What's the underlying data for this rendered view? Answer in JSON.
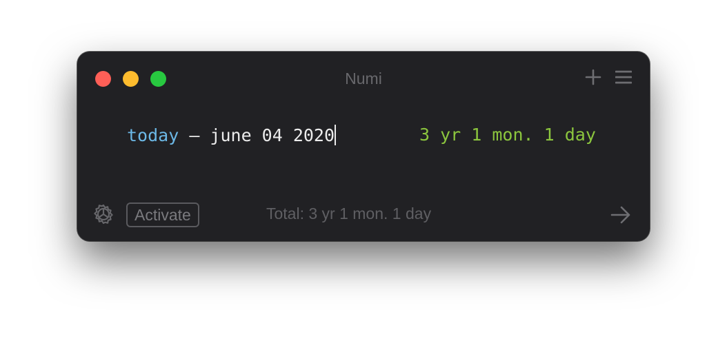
{
  "window": {
    "title": "Numi",
    "traffic_lights": {
      "close_color": "#fe5f57",
      "minimize_color": "#febc2e",
      "maximize_color": "#28c840"
    },
    "toolbar_icons": [
      "plus-icon",
      "menu-icon"
    ]
  },
  "editor": {
    "lines": [
      {
        "keyword": "today",
        "expression": " – june 04 2020",
        "result": "3 yr 1 mon. 1 day"
      }
    ],
    "keyword_color": "#6cb8e6",
    "result_color": "#8cc63e"
  },
  "footer": {
    "settings_icon": "gear-icon",
    "activate_label": "Activate",
    "total_text": "Total: 3 yr 1 mon. 1 day",
    "share_icon": "arrow-right-icon"
  }
}
